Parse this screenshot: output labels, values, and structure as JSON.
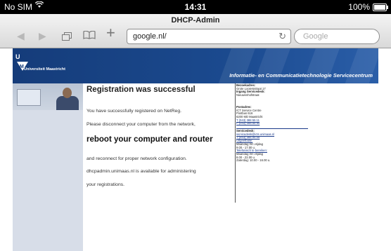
{
  "status_bar": {
    "carrier": "No SIM",
    "time": "14:31",
    "battery": "100%",
    "icons": [
      "wifi-icon",
      "battery-icon"
    ]
  },
  "browser": {
    "page_title": "DHCP-Admin",
    "url": "google.nl/",
    "search_placeholder": "Google",
    "icons": [
      "back-icon",
      "forward-icon",
      "tabs-icon",
      "bookmarks-icon",
      "add-icon",
      "reload-icon"
    ]
  },
  "site": {
    "logo_text": "Universiteit Maastricht",
    "department": "Informatie- en Communicatietechnologie Servicecentrum"
  },
  "content": {
    "heading": "Registration was successful",
    "line1": "You have successfully registered on NetReg.",
    "line2": "Please disconnect your computer from the network,",
    "emphasis": "reboot your computer and router",
    "line3": "and reconnect for proper network configuration.",
    "line4": "dhcpadmin.unimaas.nl is available for administering",
    "line5": "your registrations."
  },
  "sidebar": {
    "visit_label": "Bezoekadres:",
    "visit_street": "Grote Looiersstraat 17",
    "entrance_label": "Ingang Servicedesk:",
    "entrance_value": "Nieuwenhofstraat",
    "postal_label": "Postadres:",
    "postal_name": "ICT Service Centre",
    "postal_box": "Postbus 616",
    "postal_city": "6200 MD Maastricht",
    "phone": "T (043) 388 55 11",
    "fax": "F (043) 388 55 90",
    "servicedesk_label": "Servicedesk:",
    "servicedesk_email": "servicedesk@icts.unimaas.nl",
    "servicedesk_phone": "T (043) 388 55 55",
    "hours_label": "Uitgeefbalie:",
    "hours_days": "Maandag t/m vrijdag",
    "hours_time": "9.00 - 17.00 u.",
    "phone_hours_label": "Telefonisch te bereiken:",
    "phone_hours_days": "Maandag t/m vrijdag",
    "phone_hours_time": "8.00 - 22.00 u.",
    "saturday": "Zaterdag: 10.00 - 16.00 u."
  }
}
